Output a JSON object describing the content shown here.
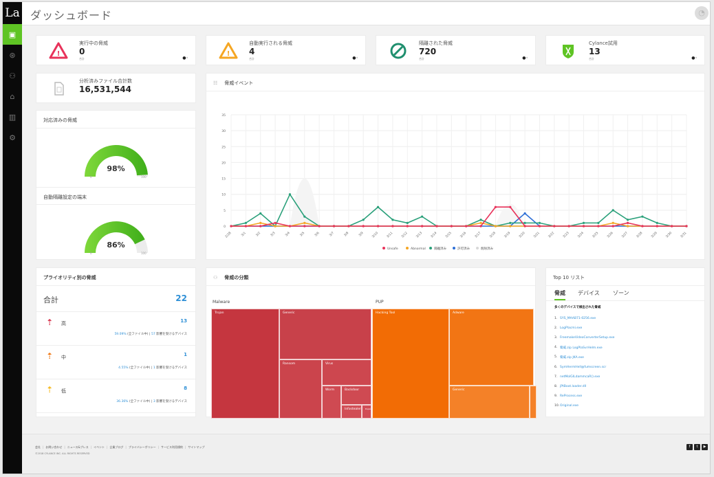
{
  "app": {
    "logo": "La",
    "title": "ダッシュボード",
    "avatar_icon": "user-icon"
  },
  "sidebar": {
    "items": [
      {
        "name": "dashboard",
        "icon": "▣",
        "active": true
      },
      {
        "name": "protection",
        "icon": "⊛"
      },
      {
        "name": "zones",
        "icon": "⚇"
      },
      {
        "name": "devices",
        "icon": "⌂"
      },
      {
        "name": "reports",
        "icon": "▥"
      },
      {
        "name": "settings",
        "icon": "⚙"
      }
    ]
  },
  "stats": [
    {
      "label": "実行中の脅威",
      "value": "0",
      "sub": "合計",
      "icon": "warning-red",
      "color": "#e8325a"
    },
    {
      "label": "自動実行される脅威",
      "value": "4",
      "sub": "合計",
      "icon": "warning-orange",
      "color": "#f5a623"
    },
    {
      "label": "隔離された脅威",
      "value": "720",
      "sub": "合計",
      "icon": "blocked",
      "color": "#1f8f6e"
    },
    {
      "label": "Cylance試用",
      "value": "13",
      "sub": "合計",
      "icon": "shield-green",
      "color": "#5fc424"
    }
  ],
  "files": {
    "label": "分析済みファイル合計数",
    "value": "16,531,544"
  },
  "gauges": [
    {
      "title": "対応済みの脅威",
      "value_text": "98%",
      "fraction": 0.98,
      "min": "0",
      "max": "100"
    },
    {
      "title": "自動隔離設定の端末",
      "value_text": "86%",
      "fraction": 0.86,
      "min": "0",
      "max": "100"
    }
  ],
  "events": {
    "title": "脅威イベント"
  },
  "chart_data": {
    "type": "line",
    "title": "脅威イベント",
    "xlabel": "",
    "ylabel": "",
    "ylim": [
      0,
      35
    ],
    "yticks": [
      0,
      5,
      10,
      15,
      20,
      25,
      30,
      35
    ],
    "grid": true,
    "legend": "bottom-right",
    "x": [
      "2/28",
      "3/1",
      "3/2",
      "3/3",
      "3/4",
      "3/5",
      "3/6",
      "3/7",
      "3/8",
      "3/9",
      "3/10",
      "3/11",
      "3/12",
      "3/13",
      "3/14",
      "3/15",
      "3/16",
      "3/17",
      "3/18",
      "3/19",
      "3/20",
      "3/21",
      "3/22",
      "3/23",
      "3/24",
      "3/25",
      "3/26",
      "3/27",
      "3/28",
      "3/29",
      "3/30",
      "3/31"
    ],
    "series": [
      {
        "name": "Unsafe",
        "color": "#e8325a",
        "values": [
          0,
          0,
          0,
          1,
          0,
          0,
          0,
          0,
          0,
          0,
          0,
          0,
          0,
          0,
          0,
          0,
          0,
          0,
          6,
          6,
          0,
          0,
          0,
          0,
          0,
          0,
          0,
          1,
          0,
          0,
          0,
          0
        ]
      },
      {
        "name": "Abnormal",
        "color": "#f5a623",
        "values": [
          0,
          0,
          1,
          0,
          0,
          1,
          0,
          0,
          0,
          0,
          0,
          0,
          0,
          0,
          0,
          0,
          0,
          1,
          0,
          0,
          0,
          0,
          0,
          0,
          0,
          0,
          1,
          0,
          0,
          0,
          0,
          0
        ]
      },
      {
        "name": "隔離済み",
        "color": "#2aa07a",
        "values": [
          0,
          1,
          4,
          0,
          10,
          3,
          0,
          0,
          0,
          2,
          6,
          2,
          1,
          3,
          0,
          0,
          0,
          2,
          0,
          1,
          1,
          1,
          0,
          0,
          1,
          1,
          5,
          2,
          3,
          1,
          0,
          0
        ]
      },
      {
        "name": "許可済み",
        "color": "#2e6fd6",
        "values": [
          0,
          0,
          0,
          0,
          0,
          0,
          0,
          0,
          0,
          0,
          0,
          0,
          0,
          0,
          0,
          0,
          0,
          0,
          0,
          0,
          4,
          0,
          0,
          0,
          0,
          0,
          0,
          0,
          0,
          0,
          0,
          0
        ]
      },
      {
        "name": "削除済み",
        "color": "#d8d8d8",
        "values": [
          0,
          0,
          0,
          0,
          0,
          0,
          0,
          0,
          0,
          0,
          0,
          0,
          0,
          0,
          0,
          0,
          0,
          0,
          0,
          0,
          0,
          0,
          0,
          0,
          0,
          0,
          0,
          0,
          0,
          0,
          0,
          0
        ]
      }
    ]
  },
  "priority": {
    "title": "プライオリティ別の脅威",
    "total_label": "合計",
    "total": "22",
    "rows": [
      {
        "level": "高",
        "count": "13",
        "pct": "59.09%",
        "pct_text": "(全ファイル中)",
        "devices": "57",
        "devices_text": "影響を受けるデバイス",
        "color": "#d6314a"
      },
      {
        "level": "中",
        "count": "1",
        "pct": "4.55%",
        "pct_text": "(全ファイル中)",
        "devices": "1",
        "devices_text": "影響を受けるデバイス",
        "color": "#f07b1a"
      },
      {
        "level": "低",
        "count": "8",
        "pct": "36.36%",
        "pct_text": "(全ファイル中)",
        "devices": "3",
        "devices_text": "影響を受けるデバイス",
        "color": "#f5b81a"
      }
    ]
  },
  "classification": {
    "title": "脅威の分類",
    "groups": [
      {
        "label": "Malware",
        "color": "#c83d45",
        "items": [
          "Trojan",
          "Generic",
          "Ransom",
          "Virus",
          "Worm",
          "Backdoor",
          "Infostealer",
          "Exploit"
        ]
      },
      {
        "label": "PUP",
        "color": "#f06d0a",
        "items": [
          "Hacking Tool",
          "Adware",
          "Generic"
        ]
      }
    ]
  },
  "top10": {
    "title": "Top 10 リスト",
    "tabs": [
      "脅威",
      "デバイス",
      "ゾーン"
    ],
    "caption": "多くのデバイスで検出された脅威",
    "items": [
      "SYS_MAAB71-0256.exe",
      "LogPlacmi.exe",
      "FreemakeVideoConverterSetup.exe",
      "脅威.zip LogPlaSvrHelm.exe",
      "脅威.zip JKA.exe",
      "SymHermHell@fumscreen.scr",
      "netMolGILdammcaR().exe",
      "jPtBoot.loader.dll",
      "ReProcess.exe",
      "Original.exe"
    ]
  },
  "footer": {
    "links": [
      "会社",
      "お問い合わせ",
      "ニュース&プレス",
      "イベント",
      "企業ブログ",
      "プライバシーポリシー",
      "サービス利用規約",
      "サイトマップ"
    ],
    "copyright": "©2018 CYLANCE INC. ALL RIGHTS RESERVED",
    "social": [
      "f",
      "t",
      "▶"
    ]
  }
}
